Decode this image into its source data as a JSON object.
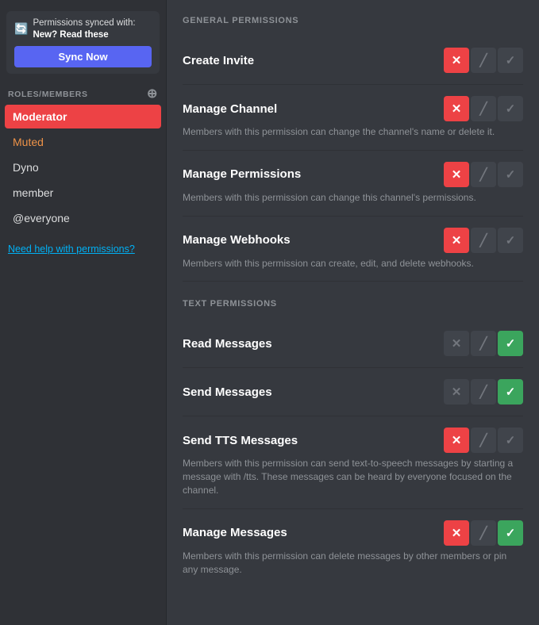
{
  "sidebar": {
    "sync_banner": {
      "icon": "🔄",
      "text": "Permissions synced with:",
      "link_text": "New? Read these",
      "sync_btn": "Sync Now"
    },
    "section_label": "ROLES/MEMBERS",
    "roles": [
      {
        "name": "Moderator",
        "state": "active"
      },
      {
        "name": "Muted",
        "state": "muted"
      },
      {
        "name": "Dyno",
        "state": "normal"
      },
      {
        "name": "member",
        "state": "normal"
      },
      {
        "name": "@everyone",
        "state": "normal"
      }
    ],
    "help_link": "Need help with permissions?"
  },
  "main": {
    "general_section": "GENERAL PERMISSIONS",
    "text_section": "TEXT PERMISSIONS",
    "permissions": [
      {
        "name": "Create Invite",
        "desc": "",
        "deny": true,
        "neutral": true,
        "allow": true,
        "active": "neutral"
      },
      {
        "name": "Manage Channel",
        "desc": "Members with this permission can change the channel's name or delete it.",
        "deny": true,
        "neutral": true,
        "allow": true,
        "active": "deny"
      },
      {
        "name": "Manage Permissions",
        "desc": "Members with this permission can change this channel's permissions.",
        "deny": true,
        "neutral": true,
        "allow": true,
        "active": "deny"
      },
      {
        "name": "Manage Webhooks",
        "desc": "Members with this permission can create, edit, and delete webhooks.",
        "deny": true,
        "neutral": true,
        "allow": true,
        "active": "deny"
      }
    ],
    "text_permissions": [
      {
        "name": "Read Messages",
        "desc": "",
        "active": "allow"
      },
      {
        "name": "Send Messages",
        "desc": "",
        "active": "allow"
      },
      {
        "name": "Send TTS Messages",
        "desc": "Members with this permission can send text-to-speech messages by starting a message with /tts. These messages can be heard by everyone focused on the channel.",
        "active": "deny"
      },
      {
        "name": "Manage Messages",
        "desc": "Members with this permission can delete messages by other members or pin any message.",
        "active": "allow"
      }
    ]
  }
}
